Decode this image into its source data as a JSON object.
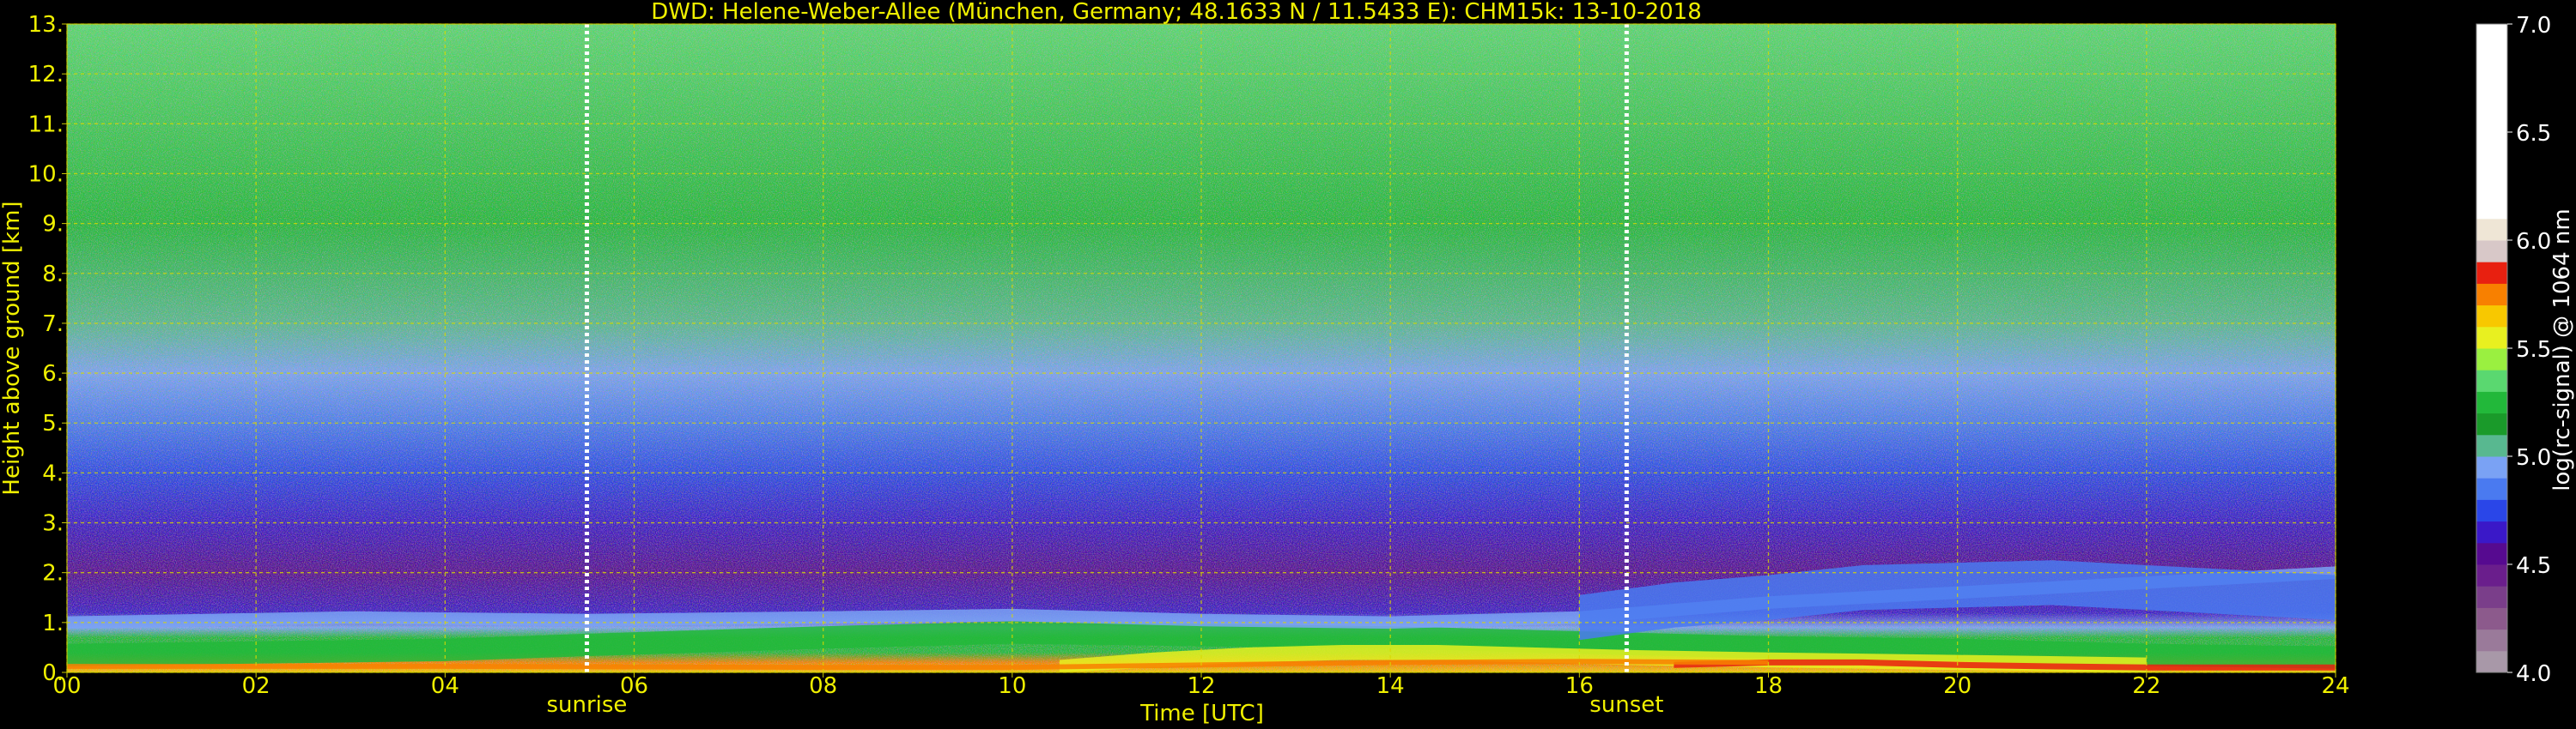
{
  "chart_data": {
    "type": "heatmap",
    "title": "DWD: Helene-Weber-Allee (München, Germany; 48.1633 N / 11.5433 E):    CHM15k: 13-10-2018",
    "xlabel": "Time [UTC]",
    "ylabel": "Height above ground [km]",
    "xlim": [
      0,
      24
    ],
    "ylim": [
      0,
      13
    ],
    "x_ticks": [
      0,
      2,
      4,
      6,
      8,
      10,
      12,
      14,
      16,
      18,
      20,
      22,
      24
    ],
    "x_tick_labels": [
      "00",
      "02",
      "04",
      "06",
      "08",
      "10",
      "12",
      "14",
      "16",
      "18",
      "20",
      "22",
      "24"
    ],
    "y_ticks": [
      0,
      1,
      2,
      3,
      4,
      5,
      6,
      7,
      8,
      9,
      10,
      11,
      12,
      13
    ],
    "y_tick_labels": [
      "0.",
      "1.",
      "2.",
      "3.",
      "4.",
      "5.",
      "6.",
      "7.",
      "8.",
      "9.",
      "10.",
      "11.",
      "12.",
      "13."
    ],
    "grid": true,
    "markers": [
      {
        "label": "sunrise",
        "x": 5.5
      },
      {
        "label": "sunset",
        "x": 16.5
      }
    ],
    "colorbar": {
      "label": "log(rc-signal) @ 1064 nm",
      "range": [
        4.0,
        7.0
      ],
      "ticks": [
        4.0,
        4.5,
        5.0,
        5.5,
        6.0,
        6.5,
        7.0
      ],
      "tick_labels": [
        "4.0",
        "4.5",
        "5.0",
        "5.5",
        "6.0",
        "6.5",
        "7.0"
      ],
      "levels": [
        {
          "from": 4.0,
          "to": 4.1,
          "color": "#a898a8"
        },
        {
          "from": 4.1,
          "to": 4.2,
          "color": "#9a7a9a"
        },
        {
          "from": 4.2,
          "to": 4.3,
          "color": "#8c5a8c"
        },
        {
          "from": 4.3,
          "to": 4.4,
          "color": "#7a3e8a"
        },
        {
          "from": 4.4,
          "to": 4.5,
          "color": "#6a1e8c"
        },
        {
          "from": 4.5,
          "to": 4.6,
          "color": "#560a90"
        },
        {
          "from": 4.6,
          "to": 4.7,
          "color": "#3a18c8"
        },
        {
          "from": 4.7,
          "to": 4.8,
          "color": "#2a46e8"
        },
        {
          "from": 4.8,
          "to": 4.9,
          "color": "#4a7af0"
        },
        {
          "from": 4.9,
          "to": 5.0,
          "color": "#7aa2f4"
        },
        {
          "from": 5.0,
          "to": 5.1,
          "color": "#58b890"
        },
        {
          "from": 5.1,
          "to": 5.2,
          "color": "#1a9a2a"
        },
        {
          "from": 5.2,
          "to": 5.3,
          "color": "#22b83a"
        },
        {
          "from": 5.3,
          "to": 5.4,
          "color": "#5ad870"
        },
        {
          "from": 5.4,
          "to": 5.5,
          "color": "#9af040"
        },
        {
          "from": 5.5,
          "to": 5.6,
          "color": "#e8f020"
        },
        {
          "from": 5.6,
          "to": 5.7,
          "color": "#f8c800"
        },
        {
          "from": 5.7,
          "to": 5.8,
          "color": "#f88000"
        },
        {
          "from": 5.8,
          "to": 5.9,
          "color": "#e82010"
        },
        {
          "from": 5.9,
          "to": 6.0,
          "color": "#d8c8c8"
        },
        {
          "from": 6.0,
          "to": 6.1,
          "color": "#efe6d6"
        },
        {
          "from": 6.1,
          "to": 7.0,
          "color": "#ffffff"
        }
      ]
    },
    "background_signal": [
      {
        "height": 0.0,
        "value": 5.6
      },
      {
        "height": 0.2,
        "value": 5.75
      },
      {
        "height": 0.4,
        "value": 5.25
      },
      {
        "height": 0.7,
        "value": 5.2
      },
      {
        "height": 0.9,
        "value": 4.95
      },
      {
        "height": 1.2,
        "value": 4.6
      },
      {
        "height": 2.0,
        "value": 4.5
      },
      {
        "height": 3.0,
        "value": 4.6
      },
      {
        "height": 4.0,
        "value": 4.75
      },
      {
        "height": 5.0,
        "value": 4.85
      },
      {
        "height": 6.0,
        "value": 4.9
      },
      {
        "height": 7.0,
        "value": 5.0
      },
      {
        "height": 9.0,
        "value": 5.2
      },
      {
        "height": 13.0,
        "value": 5.3
      }
    ],
    "layers": [
      {
        "name": "",
        "value": 5.2,
        "points": [
          [
            0,
            0.35
          ],
          [
            2,
            0.4
          ],
          [
            4,
            0.45
          ],
          [
            5.5,
            0.55
          ],
          [
            8,
            0.7
          ],
          [
            10,
            0.8
          ],
          [
            12,
            0.75
          ],
          [
            14,
            0.7
          ],
          [
            16,
            0.6
          ],
          [
            18,
            0.5
          ],
          [
            20,
            0.45
          ],
          [
            22,
            0.35
          ],
          [
            24,
            0.3
          ]
        ],
        "thickness": 0.45
      },
      {
        "name": "",
        "value": 4.95,
        "points": [
          [
            0,
            1.0
          ],
          [
            3,
            1.1
          ],
          [
            5.5,
            1.05
          ],
          [
            8,
            1.1
          ],
          [
            10,
            1.15
          ],
          [
            12,
            1.05
          ],
          [
            14,
            1.0
          ],
          [
            16,
            1.1
          ],
          [
            18,
            1.4
          ],
          [
            20,
            1.6
          ],
          [
            22,
            1.8
          ],
          [
            24,
            2.0
          ]
        ],
        "thickness": 0.25
      },
      {
        "name": "",
        "value": 4.85,
        "points": [
          [
            16,
            1.1
          ],
          [
            17,
            1.35
          ],
          [
            18,
            1.5
          ],
          [
            19,
            1.7
          ],
          [
            20,
            1.75
          ],
          [
            21,
            1.8
          ],
          [
            22,
            1.7
          ],
          [
            23,
            1.6
          ],
          [
            24,
            1.5
          ]
        ],
        "thickness": 0.9
      },
      {
        "name": "",
        "value": 5.55,
        "points": [
          [
            10.5,
            0.1
          ],
          [
            11.5,
            0.25
          ],
          [
            12.5,
            0.35
          ],
          [
            13.5,
            0.4
          ],
          [
            14.5,
            0.4
          ],
          [
            15.5,
            0.35
          ],
          [
            16.5,
            0.3
          ],
          [
            18,
            0.25
          ],
          [
            20,
            0.2
          ],
          [
            22,
            0.15
          ]
        ],
        "thickness": 0.3
      },
      {
        "name": "",
        "value": 5.85,
        "points": [
          [
            17,
            0.15
          ],
          [
            18,
            0.2
          ],
          [
            19,
            0.2
          ],
          [
            20,
            0.15
          ],
          [
            21,
            0.12
          ],
          [
            22,
            0.1
          ],
          [
            24,
            0.1
          ]
        ],
        "thickness": 0.12
      },
      {
        "name": "",
        "value": 5.75,
        "points": [
          [
            0,
            0.12
          ],
          [
            4,
            0.12
          ],
          [
            8,
            0.1
          ],
          [
            10,
            0.1
          ],
          [
            12,
            0.15
          ],
          [
            14,
            0.2
          ],
          [
            16,
            0.22
          ],
          [
            18,
            0.2
          ]
        ],
        "thickness": 0.1
      }
    ]
  }
}
